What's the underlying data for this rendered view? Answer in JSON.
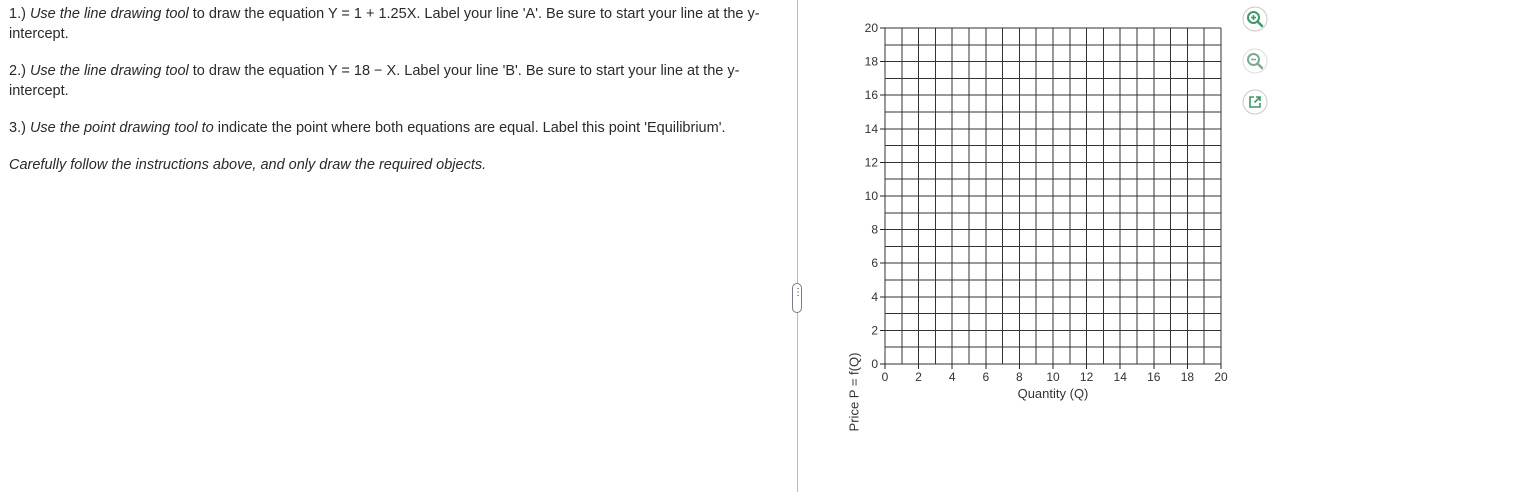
{
  "instructions": {
    "item1": {
      "num": "1.)",
      "italic": "Use the line drawing tool",
      "text": " to draw the equation Y = 1 + 1.25X. Label your line 'A'. Be sure to start your line at the y-intercept."
    },
    "item2": {
      "num": "2.)",
      "italic": "Use the line drawing tool",
      "text": " to draw the equation Y = 18 − X. Label your line 'B'. Be sure to start your line at the y-intercept."
    },
    "item3": {
      "num": "3.)",
      "italic": "Use the point drawing tool to",
      "text": " indicate the point where both equations are equal. Label this point 'Equilibrium'."
    },
    "note": "Carefully follow the instructions above, and only draw the required objects."
  },
  "pane_handle": {
    "glyph": "⋮"
  },
  "graph": {
    "x_axis_title": "Quantity (Q)",
    "y_axis_title": "Price P = f(Q)",
    "x_min": 0,
    "x_max": 20,
    "y_min": 0,
    "y_max": 20,
    "grid_step": 1,
    "label_step": 2,
    "x_tick_labels": [
      "0",
      "2",
      "4",
      "6",
      "8",
      "10",
      "12",
      "14",
      "16",
      "18",
      "20"
    ],
    "y_tick_labels": [
      "0",
      "2",
      "4",
      "6",
      "8",
      "10",
      "12",
      "14",
      "16",
      "18",
      "20"
    ],
    "colors": {
      "grid": "#333333",
      "axis": "#222222"
    }
  },
  "tools": {
    "zoom_in": {
      "icon": "zoom-in-icon",
      "color": "#3a9a6a"
    },
    "zoom_out": {
      "icon": "zoom-out-icon",
      "color": "#7aaa90"
    },
    "popout": {
      "icon": "popout-icon",
      "color": "#3a9a6a"
    }
  }
}
